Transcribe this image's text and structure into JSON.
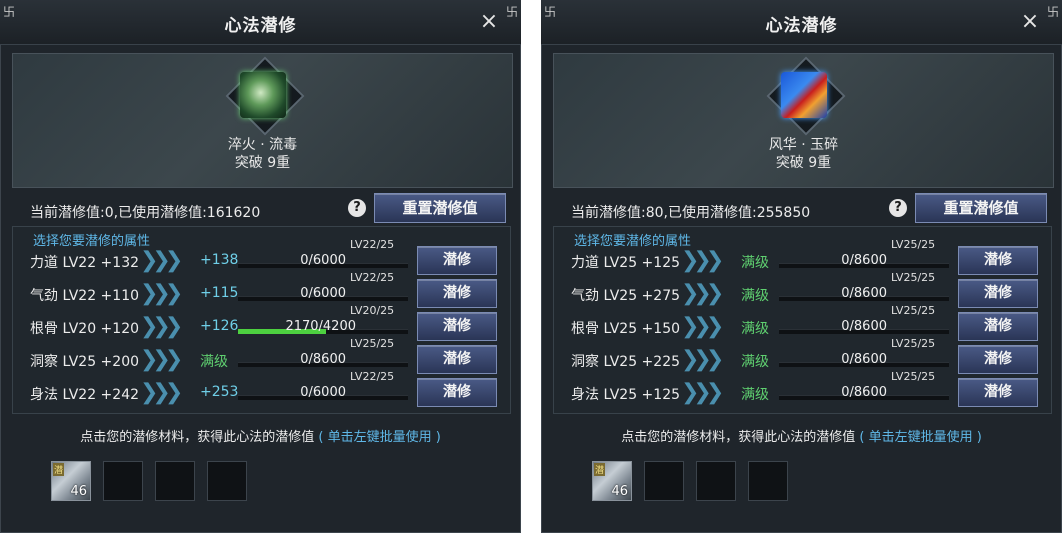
{
  "panels": [
    {
      "title": "心法潜修",
      "close_icon": "×",
      "corner_glyph": "卐",
      "skill": {
        "name": "淬火 · 流毒",
        "breakthrough": "突破 9重",
        "icon": "poison-book-icon"
      },
      "summary": "当前潜修值:0,已使用潜修值:161620",
      "help_icon": "?",
      "reset_label": "重置潜修值",
      "choose_label": "选择您要潜修的属性",
      "rows": [
        {
          "label": "力道 LV22 +132",
          "bonus": "+138",
          "progress": "0/6000",
          "level": "LV22/25",
          "fill": 0,
          "btn": "潜修",
          "max": false
        },
        {
          "label": "气劲 LV22 +110",
          "bonus": "+115",
          "progress": "0/6000",
          "level": "LV22/25",
          "fill": 0,
          "btn": "潜修",
          "max": false
        },
        {
          "label": "根骨 LV20 +120",
          "bonus": "+126",
          "progress": "2170/4200",
          "level": "LV20/25",
          "fill": 0.517,
          "btn": "潜修",
          "max": false
        },
        {
          "label": "洞察 LV25 +200",
          "bonus": "满级",
          "progress": "0/8600",
          "level": "LV25/25",
          "fill": 0,
          "btn": "潜修",
          "max": true
        },
        {
          "label": "身法 LV22 +242",
          "bonus": "+253",
          "progress": "0/6000",
          "level": "LV22/25",
          "fill": 0,
          "btn": "潜修",
          "max": false
        }
      ],
      "hint_main": "点击您的潜修材料，获得此心法的潜修值",
      "hint_link": "( 单击左键批量使用 )",
      "material": {
        "tag": "潜",
        "count": "46"
      }
    },
    {
      "title": "心法潜修",
      "close_icon": "×",
      "corner_glyph": "卐",
      "skill": {
        "name": "风华 · 玉碎",
        "breakthrough": "突破 9重",
        "icon": "jade-book-icon"
      },
      "summary": "当前潜修值:80,已使用潜修值:255850",
      "help_icon": "?",
      "reset_label": "重置潜修值",
      "choose_label": "选择您要潜修的属性",
      "rows": [
        {
          "label": "力道 LV25 +125",
          "bonus": "满级",
          "progress": "0/8600",
          "level": "LV25/25",
          "fill": 0,
          "btn": "潜修",
          "max": true
        },
        {
          "label": "气劲 LV25 +275",
          "bonus": "满级",
          "progress": "0/8600",
          "level": "LV25/25",
          "fill": 0,
          "btn": "潜修",
          "max": true
        },
        {
          "label": "根骨 LV25 +150",
          "bonus": "满级",
          "progress": "0/8600",
          "level": "LV25/25",
          "fill": 0,
          "btn": "潜修",
          "max": true
        },
        {
          "label": "洞察 LV25 +225",
          "bonus": "满级",
          "progress": "0/8600",
          "level": "LV25/25",
          "fill": 0,
          "btn": "潜修",
          "max": true
        },
        {
          "label": "身法 LV25 +125",
          "bonus": "满级",
          "progress": "0/8600",
          "level": "LV25/25",
          "fill": 0,
          "btn": "潜修",
          "max": true
        }
      ],
      "hint_main": "点击您的潜修材料，获得此心法的潜修值",
      "hint_link": "( 单击左键批量使用 )",
      "material": {
        "tag": "潜",
        "count": "46"
      }
    }
  ]
}
